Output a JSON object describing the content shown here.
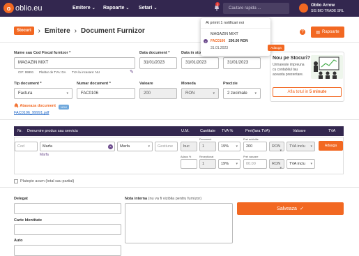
{
  "header": {
    "logo_letter": "o",
    "logo_text": "oblio.eu",
    "nav": [
      "Emitere",
      "Rapoarte",
      "Setari"
    ],
    "notif_count": "2",
    "search_placeholder": "Cautare rapida ...",
    "user_name": "Oblio Arrow",
    "user_company": "SIS BIO TRADE SRL"
  },
  "breadcrumb": {
    "stocuri": "Stocuri",
    "emitere": "Emitere",
    "page": "Document Furnizor"
  },
  "toolbar": {
    "rapoarte": "Rapoarte",
    "help": "?"
  },
  "supplier": {
    "label": "Nume sau Cod Fiscal furnizor *",
    "value": "MAGAZIN MIXT",
    "cif": "CIF: 99991",
    "tva": "Platitor de TVA: DA",
    "tva_inc": "TVA la incasare: NU"
  },
  "dates": {
    "doc_label": "Data document *",
    "doc_value": "31/01/2023",
    "in_label": "Data in stoc",
    "in_value": "31/01/2023",
    "third_value": "31/01/2023"
  },
  "doc": {
    "type_label": "Tip document *",
    "type_value": "Factura",
    "num_label": "Numar document *",
    "num_value": "FAC0106",
    "val_label": "Valoare",
    "val_value": "200",
    "cur_label": "Moneda",
    "cur_value": "RON",
    "prec_label": "Precizie",
    "prec_value": "2 zecimale"
  },
  "advert": {
    "title": "Nou pe Stocuri?",
    "text": "Urmareste impreuna cu contabilul tau aceasta prezentare.",
    "button_prefix": "Afla totul in ",
    "button_bold": "5 minute"
  },
  "attach": {
    "label": "Ataseaza document",
    "badge": "NOU",
    "file": "FAC0106_99991.pdf"
  },
  "table": {
    "headers": [
      "Nr.",
      "Denumire produs sau serviciu",
      "U.M.",
      "Cantitate",
      "TVA %",
      "Pret(fara TVA)",
      "Valoare",
      "TVA"
    ],
    "row": {
      "cod_placeholder": "Cod",
      "name": "Marfa",
      "name_sub": "Marfa",
      "type": "Marfa",
      "gestiune": "Gestiune",
      "um": "buc",
      "doc_cap": "Document",
      "doc_qty": "1",
      "tva": "19%",
      "pret_ach_cap": "Pret achizitie",
      "pret_ach": "200",
      "currency": "RON",
      "tva_inclus": "TVA inclu",
      "adaos_cap": "Adaos %",
      "recep_cap": "Receptionat",
      "recep_qty": "1",
      "tva2": "19%",
      "pret_vanz_cap": "Pret vanzare",
      "pret_vanz": "00.00",
      "currency2": "RON",
      "tva_inclus2": "TVA inclu",
      "add_button": "Adauga"
    }
  },
  "platit": "Platește acum (total sau partial)",
  "bottom": {
    "delegat": "Delegat",
    "carte": "Carte Identitate",
    "auto": "Auto",
    "nota_label": "Nota interna",
    "nota_hint": "(nu va fi vizibila pentru furnizor)",
    "save": "Salveaza"
  },
  "notification": {
    "header": "Ai primit 1 notificari noi",
    "name": "MAGAZIN MIXT",
    "code": "FAC0106",
    "amount": "200.00 RON",
    "date": "31.01.2023",
    "button": "Adauga"
  }
}
